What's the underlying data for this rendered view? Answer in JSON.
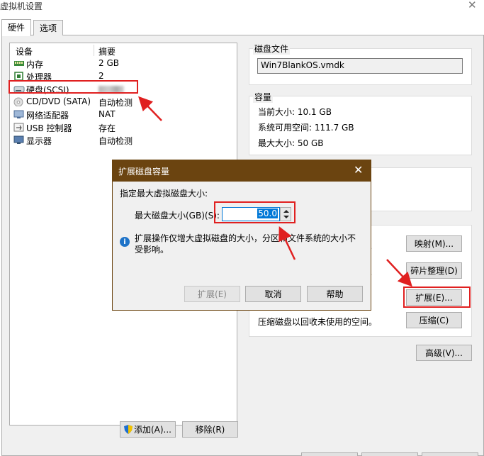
{
  "window": {
    "title": "虚拟机设置",
    "close_glyph": "✕"
  },
  "tabs": [
    {
      "label": "硬件"
    },
    {
      "label": "选项"
    }
  ],
  "device_list": {
    "headers": {
      "device": "设备",
      "summary": "摘要"
    },
    "rows": [
      {
        "name": "内存",
        "summary": "2 GB",
        "icon": "memory-icon"
      },
      {
        "name": "处理器",
        "summary": "2",
        "icon": "processor-icon"
      },
      {
        "name": "硬盘(SCSI)",
        "summary": "",
        "icon": "hard-disk-icon"
      },
      {
        "name": "CD/DVD (SATA)",
        "summary": "自动检测",
        "icon": "cd-dvd-icon"
      },
      {
        "name": "网络适配器",
        "summary": "NAT",
        "icon": "network-icon"
      },
      {
        "name": "USB 控制器",
        "summary": "存在",
        "icon": "usb-icon"
      },
      {
        "name": "显示器",
        "summary": "自动检测",
        "icon": "monitor-icon"
      }
    ],
    "add_button": "添加(A)...",
    "remove_button": "移除(R)"
  },
  "disk_file": {
    "title": "磁盘文件",
    "value": "Win7BlankOS.vmdk"
  },
  "capacity": {
    "title": "容量",
    "current_size": "当前大小: 10.1 GB",
    "available": "系统可用空间: 111.7 GB",
    "max_size": "最大大小: 50 GB"
  },
  "utilities": {
    "map_button": "映射(M)...",
    "defrag_button": "碎片整理(D)",
    "expand_button": "扩展(E)...",
    "compact_text": "压缩磁盘以回收未使用的空间。",
    "compact_button": "压缩(C)",
    "partial_dot_1": "。",
    "partial_dot_2": "。"
  },
  "advanced_button": "高级(V)...",
  "dialog": {
    "title": "扩展磁盘容量",
    "close_glyph": "✕",
    "prompt": "指定最大虚拟磁盘大小:",
    "size_label": "最大磁盘大小(GB)(S):",
    "size_value": "50.0",
    "info_glyph": "i",
    "info_text_1": "扩展操作仅增大虚拟磁盘的大小，分区和文件系统的大小不",
    "info_text_2": "受影响。",
    "expand_button": "扩展(E)",
    "cancel_button": "取消",
    "help_button": "帮助"
  },
  "colors": {
    "dialog_title_bg": "#6b4410",
    "selection_blue": "#0078d7",
    "annotation_red": "#e02020"
  }
}
